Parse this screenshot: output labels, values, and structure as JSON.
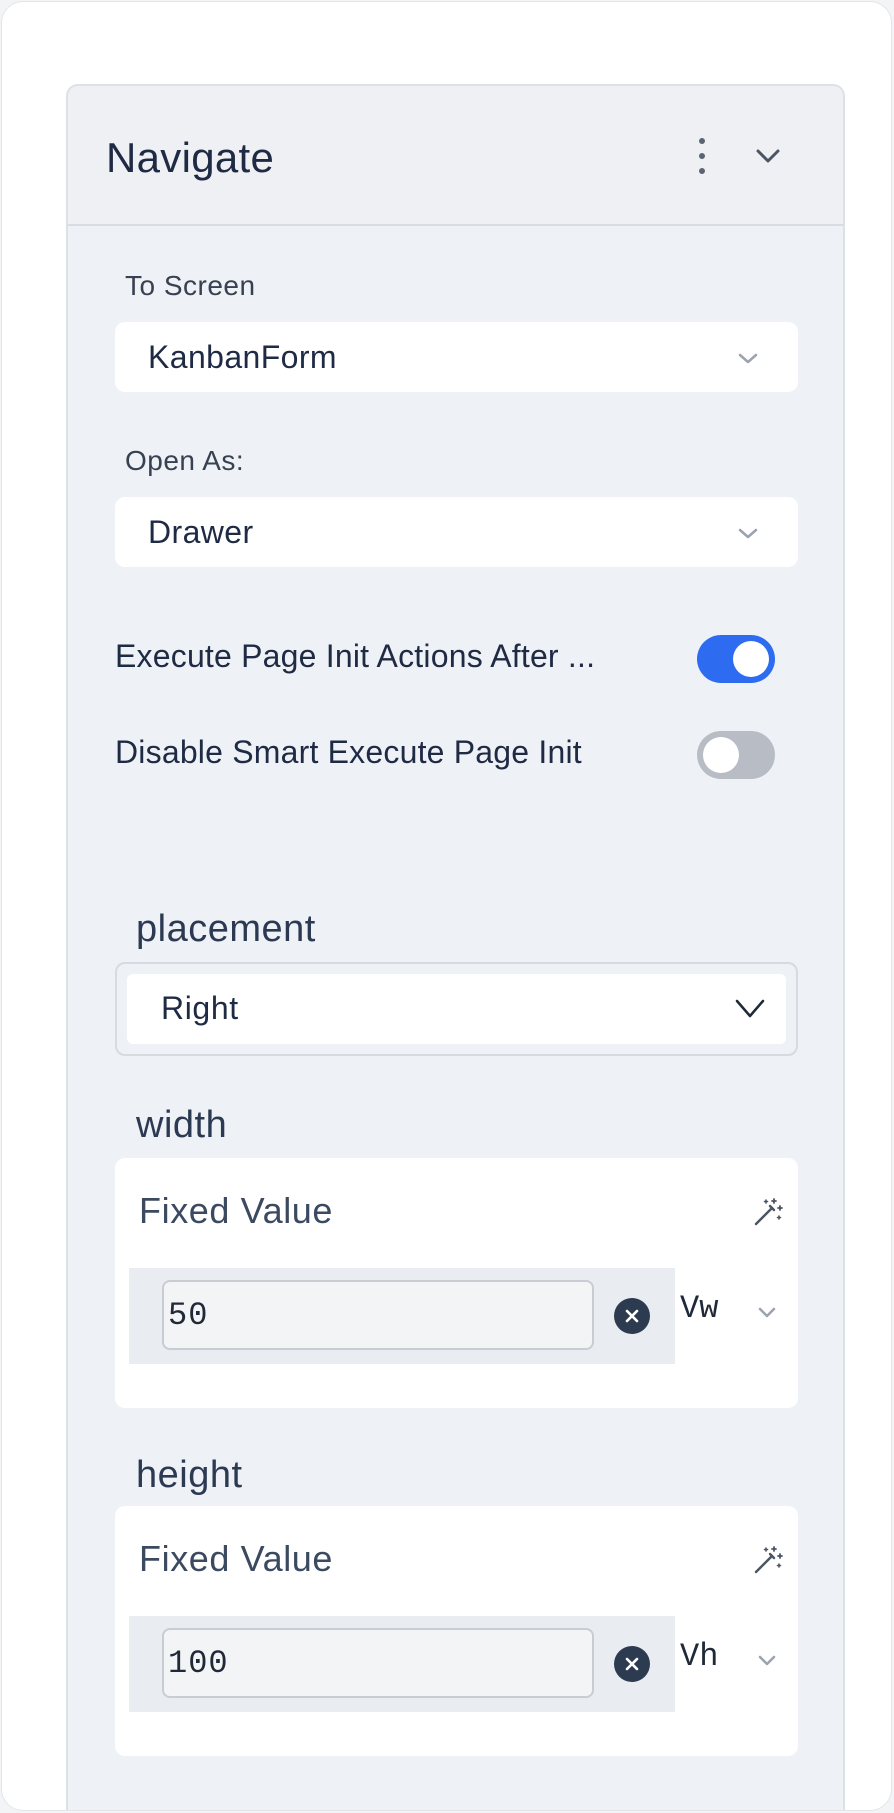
{
  "panel": {
    "title": "Navigate"
  },
  "to_screen": {
    "label": "To Screen",
    "value": "KanbanForm"
  },
  "open_as": {
    "label": "Open As:",
    "value": "Drawer"
  },
  "toggles": {
    "execute_init": {
      "label": "Execute Page Init Actions After ...",
      "on": true
    },
    "disable_smart": {
      "label": "Disable Smart Execute Page Init",
      "on": false
    }
  },
  "placement": {
    "title": "placement",
    "value": "Right"
  },
  "width": {
    "title": "width",
    "mode": "Fixed Value",
    "value": "50",
    "unit": "Vw"
  },
  "height": {
    "title": "height",
    "mode": "Fixed Value",
    "value": "100",
    "unit": "Vh"
  },
  "colors": {
    "accent": "#2d6bf0",
    "toggle_off": "#b7bcc5",
    "panel_bg": "#eef1f5"
  },
  "icons": [
    "kebab-menu-icon",
    "chevron-down-icon",
    "magic-wand-icon",
    "clear-icon"
  ]
}
